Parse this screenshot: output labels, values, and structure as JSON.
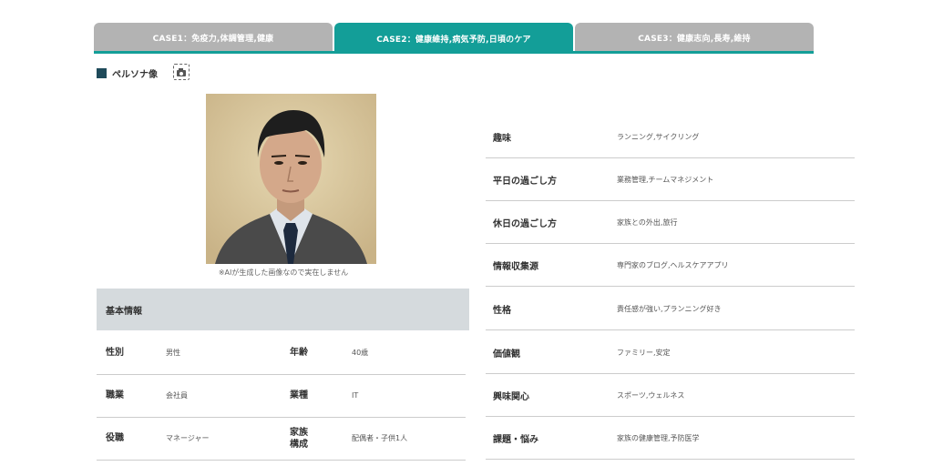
{
  "tabs": [
    {
      "label": "CASE1：免疫力,体調管理,健康"
    },
    {
      "label": "CASE2：健康維持,病気予防,日頃のケア"
    },
    {
      "label": "CASE3：健康志向,長寿,維持"
    }
  ],
  "persona": {
    "label": "ペルソナ像",
    "caption": "※AIが生成した画像なので実在しません"
  },
  "basic": {
    "title": "基本情報",
    "rows": [
      {
        "l1": "性別",
        "v1": "男性",
        "l2": "年齢",
        "v2": "40歳"
      },
      {
        "l1": "職業",
        "v1": "会社員",
        "l2": "業種",
        "v2": "IT"
      },
      {
        "l1": "役職",
        "v1": "マネージャー",
        "l2a": "家族",
        "l2b": "構成",
        "v2": "配偶者・子供1人"
      }
    ]
  },
  "details": [
    {
      "label": "趣味",
      "value": "ランニング,サイクリング"
    },
    {
      "label": "平日の過ごし方",
      "value": "業務管理,チームマネジメント"
    },
    {
      "label": "休日の過ごし方",
      "value": "家族との外出,旅行"
    },
    {
      "label": "情報収集源",
      "value": "専門家のブログ,ヘルスケアアプリ"
    },
    {
      "label": "性格",
      "value": "責任感が強い,プランニング好き"
    },
    {
      "label": "価値観",
      "value": "ファミリー,安定"
    },
    {
      "label": "興味関心",
      "value": "スポーツ,ウェルネス"
    },
    {
      "label": "課題・悩み",
      "value": "家族の健康管理,予防医学"
    }
  ]
}
